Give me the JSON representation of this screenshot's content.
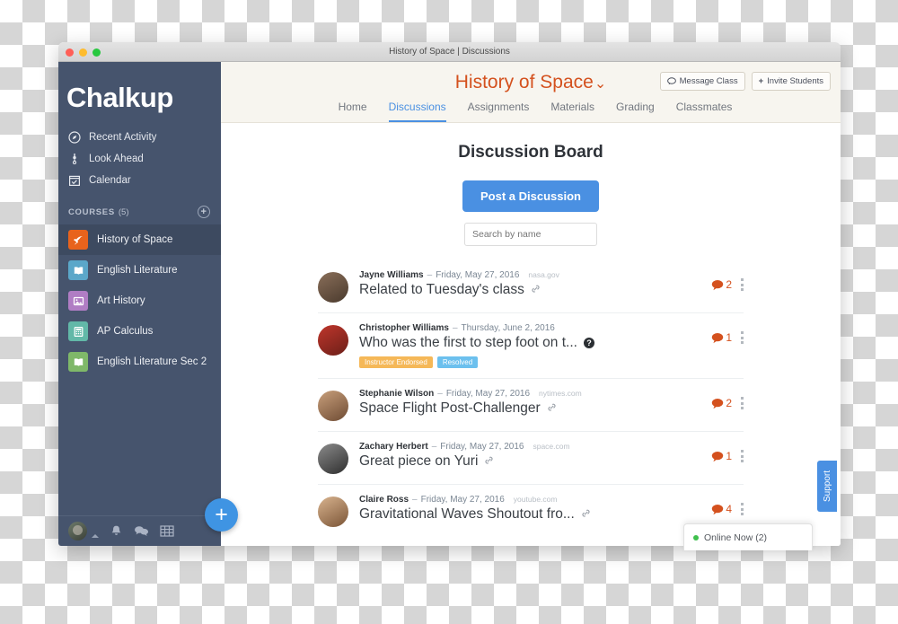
{
  "window": {
    "title": "History of Space | Discussions"
  },
  "sidebar": {
    "brand": "Chalkup",
    "nav": [
      {
        "label": "Recent Activity",
        "icon": "compass-icon"
      },
      {
        "label": "Look Ahead",
        "icon": "look-ahead-icon"
      },
      {
        "label": "Calendar",
        "icon": "calendar-icon"
      }
    ],
    "courses_header": "COURSES",
    "courses_count": "(5)",
    "add_course_label": "+",
    "courses": [
      {
        "label": "History of Space",
        "color": "#e8631c",
        "icon": "rocket-icon",
        "active": true
      },
      {
        "label": "English Literature",
        "color": "#5ba7c9",
        "icon": "book-icon",
        "active": false
      },
      {
        "label": "Art History",
        "color": "#b07dc4",
        "icon": "image-icon",
        "active": false
      },
      {
        "label": "AP Calculus",
        "color": "#62b8a8",
        "icon": "calculator-icon",
        "active": false
      },
      {
        "label": "English Literature Sec 2",
        "color": "#7fb869",
        "icon": "book-icon",
        "active": false
      }
    ],
    "bottom_icons": [
      "avatar",
      "bell-icon",
      "chat-icon",
      "grid-icon"
    ],
    "fab_label": "+"
  },
  "header": {
    "course_title": "History of Space",
    "chevron": "⌄",
    "message_class": "Message Class",
    "invite_students": "Invite Students",
    "tabs": [
      {
        "label": "Home",
        "active": false
      },
      {
        "label": "Discussions",
        "active": true
      },
      {
        "label": "Assignments",
        "active": false
      },
      {
        "label": "Materials",
        "active": false
      },
      {
        "label": "Grading",
        "active": false
      },
      {
        "label": "Classmates",
        "active": false
      }
    ]
  },
  "board": {
    "title": "Discussion Board",
    "post_button": "Post a Discussion",
    "search_placeholder": "Search by name",
    "search_value": ""
  },
  "discussions": [
    {
      "author": "Jayne Williams",
      "dash": "–",
      "date": "Friday, May 27, 2016",
      "source": "nasa.gov",
      "title": "Related to Tuesday's class",
      "has_link": true,
      "has_question": false,
      "comments": "2",
      "badges": [],
      "avatar_from": "#8a6f5a",
      "avatar_to": "#4a3a2d"
    },
    {
      "author": "Christopher Williams",
      "dash": "–",
      "date": "Thursday, June 2, 2016",
      "source": "",
      "title": "Who was the first to step foot on t...",
      "has_link": false,
      "has_question": true,
      "comments": "1",
      "badges": [
        {
          "label": "Instructor Endorsed",
          "kind": "endorsed"
        },
        {
          "label": "Resolved",
          "kind": "resolved"
        }
      ],
      "avatar_from": "#c0362c",
      "avatar_to": "#6b1f18"
    },
    {
      "author": "Stephanie Wilson",
      "dash": "–",
      "date": "Friday, May 27, 2016",
      "source": "nytimes.com",
      "title": "Space Flight Post-Challenger",
      "has_link": true,
      "has_question": false,
      "comments": "2",
      "badges": [],
      "avatar_from": "#c9a07c",
      "avatar_to": "#6e4b33"
    },
    {
      "author": "Zachary Herbert",
      "dash": "–",
      "date": "Friday, May 27, 2016",
      "source": "space.com",
      "title": "Great piece on Yuri",
      "has_link": true,
      "has_question": false,
      "comments": "1",
      "badges": [],
      "avatar_from": "#8c8c8c",
      "avatar_to": "#2e2e2e"
    },
    {
      "author": "Claire Ross",
      "dash": "–",
      "date": "Friday, May 27, 2016",
      "source": "youtube.com",
      "title": "Gravitational Waves Shoutout fro...",
      "has_link": true,
      "has_question": false,
      "comments": "4",
      "badges": [],
      "avatar_from": "#d9b48f",
      "avatar_to": "#7a5436"
    }
  ],
  "online_popup": {
    "label": "Online Now (2)"
  },
  "support": {
    "label": "Support"
  },
  "colors": {
    "sidebar": "#46546d",
    "accent_orange": "#d4511e",
    "accent_blue": "#4a90e2",
    "header_cream": "#f7f5ef"
  }
}
